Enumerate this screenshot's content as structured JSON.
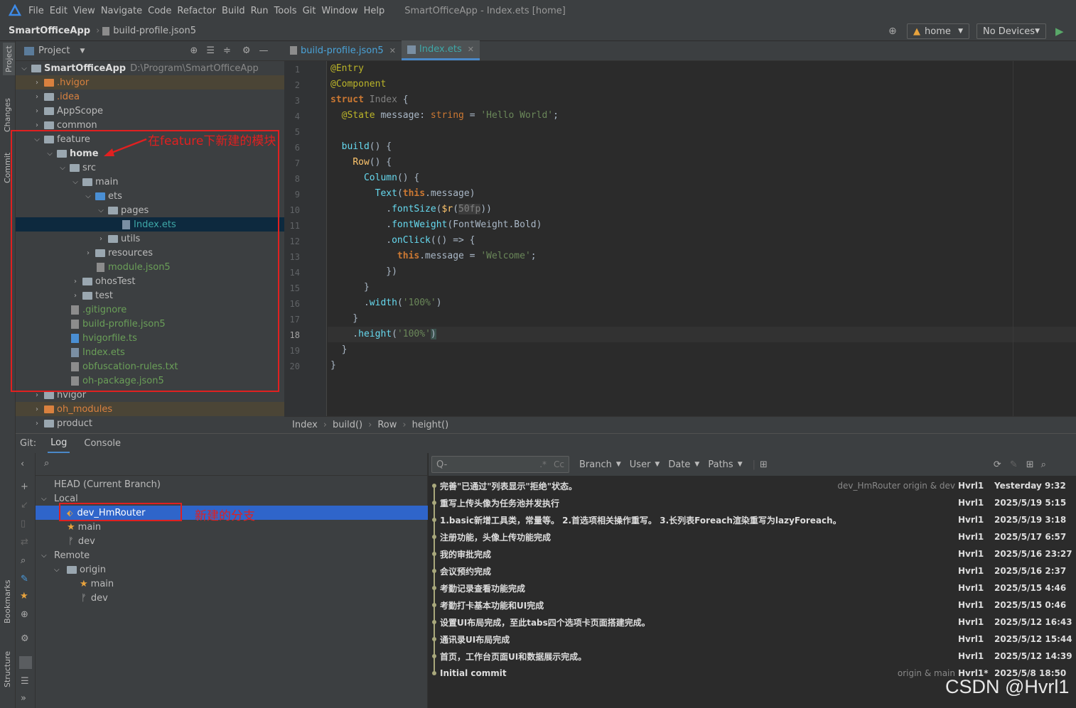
{
  "menubar": {
    "items": [
      "File",
      "Edit",
      "View",
      "Navigate",
      "Code",
      "Refactor",
      "Build",
      "Run",
      "Tools",
      "Git",
      "Window",
      "Help"
    ],
    "window_title": "SmartOfficeApp - Index.ets [home]"
  },
  "navbar": {
    "project": "SmartOfficeApp",
    "file": "build-profile.json5",
    "module_combo": "home",
    "device_combo": "No Devices"
  },
  "side_labels": [
    "Project",
    "Changes",
    "Commit",
    "Bookmarks",
    "Structure"
  ],
  "project_panel": {
    "title": "Project",
    "tree": [
      {
        "label": "SmartOfficeApp",
        "extra": "D:\\Program\\SmartOfficeApp"
      },
      {
        "label": ".hvigor"
      },
      {
        "label": ".idea"
      },
      {
        "label": "AppScope"
      },
      {
        "label": "common"
      },
      {
        "label": "feature"
      },
      {
        "label": "home"
      },
      {
        "label": "src"
      },
      {
        "label": "main"
      },
      {
        "label": "ets"
      },
      {
        "label": "pages"
      },
      {
        "label": "Index.ets"
      },
      {
        "label": "utils"
      },
      {
        "label": "resources"
      },
      {
        "label": "module.json5"
      },
      {
        "label": "ohosTest"
      },
      {
        "label": "test"
      },
      {
        "label": ".gitignore"
      },
      {
        "label": "build-profile.json5"
      },
      {
        "label": "hvigorfile.ts"
      },
      {
        "label": "Index.ets"
      },
      {
        "label": "obfuscation-rules.txt"
      },
      {
        "label": "oh-package.json5"
      },
      {
        "label": "hvigor"
      },
      {
        "label": "oh_modules"
      },
      {
        "label": "product"
      }
    ]
  },
  "annotations": {
    "module_note": "在feature下新建的模块",
    "branch_note": "新建的分支"
  },
  "editor": {
    "tabs": [
      "build-profile.json5",
      "Index.ets"
    ],
    "line_numbers": [
      "1",
      "2",
      "3",
      "4",
      "5",
      "6",
      "7",
      "8",
      "9",
      "10",
      "11",
      "12",
      "13",
      "14",
      "15",
      "16",
      "17",
      "18",
      "19",
      "20"
    ],
    "breadcrumb": [
      "Index",
      "build()",
      "Row",
      "height()"
    ]
  },
  "bottom": {
    "tabs": [
      "Git:",
      "Log",
      "Console"
    ],
    "branches": {
      "head": "HEAD (Current Branch)",
      "local": "Local",
      "local_items": [
        "dev_HmRouter",
        "main",
        "dev"
      ],
      "remote": "Remote",
      "origin": "origin",
      "remote_items": [
        "main",
        "dev"
      ]
    },
    "log_toolbar": {
      "search_placeholder": "Q-",
      "regex": ".*",
      "case": "Cc",
      "filters": [
        "Branch",
        "User",
        "Date",
        "Paths"
      ]
    },
    "commits": [
      {
        "msg": "完善\"已通过\"列表显示\"拒绝\"状态。",
        "tags": "dev_HmRouter  origin & dev",
        "author": "Hvrl1",
        "date": "Yesterday 9:32"
      },
      {
        "msg": "重写上传头像为任务池并发执行",
        "tags": "",
        "author": "Hvrl1",
        "date": "2025/5/19 5:15"
      },
      {
        "msg": "1.basic新增工具类，常量等。 2.首选项相关操作重写。 3.长列表Foreach渲染重写为lazyForeach。",
        "tags": "",
        "author": "Hvrl1",
        "date": "2025/5/19 3:18"
      },
      {
        "msg": "注册功能，头像上传功能完成",
        "tags": "",
        "author": "Hvrl1",
        "date": "2025/5/17 6:57"
      },
      {
        "msg": "我的审批完成",
        "tags": "",
        "author": "Hvrl1",
        "date": "2025/5/16 23:27"
      },
      {
        "msg": "会议预约完成",
        "tags": "",
        "author": "Hvrl1",
        "date": "2025/5/16 2:37"
      },
      {
        "msg": "考勤记录查看功能完成",
        "tags": "",
        "author": "Hvrl1",
        "date": "2025/5/15 4:46"
      },
      {
        "msg": "考勤打卡基本功能和UI完成",
        "tags": "",
        "author": "Hvrl1",
        "date": "2025/5/15 0:46"
      },
      {
        "msg": "设置UI布局完成，至此tabs四个选项卡页面搭建完成。",
        "tags": "",
        "author": "Hvrl1",
        "date": "2025/5/12 16:43"
      },
      {
        "msg": "通讯录UI布局完成",
        "tags": "",
        "author": "Hvrl1",
        "date": "2025/5/12 15:44"
      },
      {
        "msg": "首页，工作台页面UI和数据展示完成。",
        "tags": "",
        "author": "Hvrl1",
        "date": "2025/5/12 14:39"
      },
      {
        "msg": "Initial commit",
        "tags": "origin & main",
        "author": "Hvrl1*",
        "date": "2025/5/8 18:50"
      }
    ]
  },
  "watermark": "CSDN @Hvrl1"
}
